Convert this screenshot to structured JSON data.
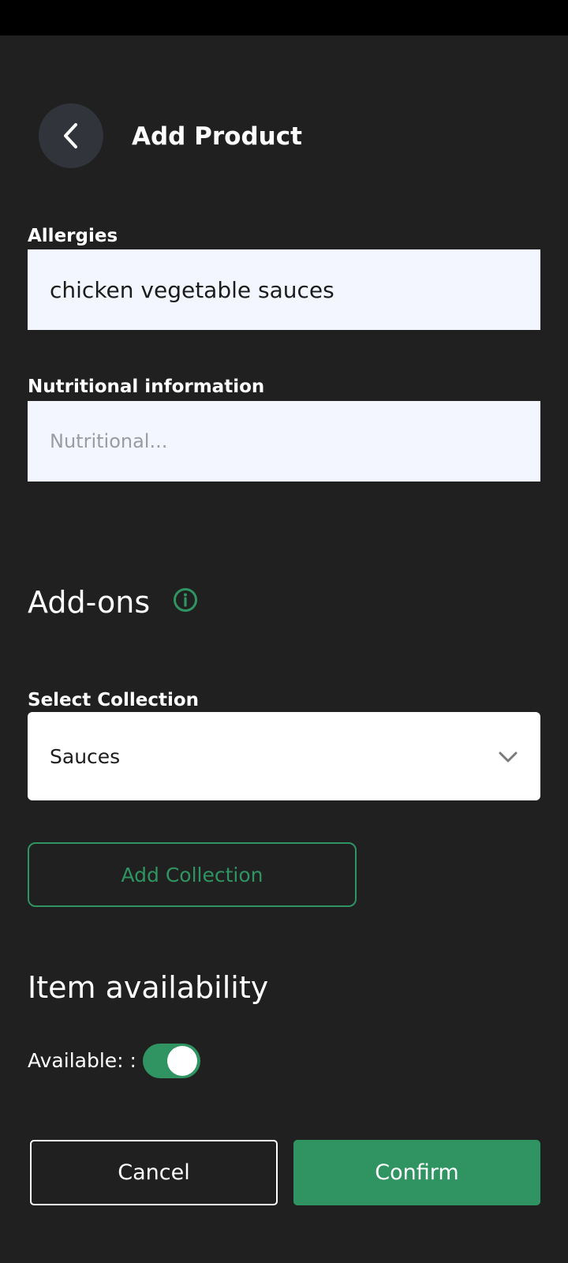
{
  "header": {
    "back_icon": "chevron-left-icon",
    "title": "Add Product"
  },
  "form": {
    "allergies": {
      "label": "Allergies",
      "value": "chicken vegetable sauces"
    },
    "nutritional": {
      "label": "Nutritional information",
      "placeholder": "Nutritional..."
    }
  },
  "addons": {
    "heading": "Add-ons",
    "info_icon": "info-icon",
    "select_label": "Select Collection",
    "selected_value": "Sauces",
    "dropdown_icon": "chevron-down-icon",
    "add_collection_label": "Add Collection"
  },
  "availability": {
    "heading": "Item availability",
    "label": "Available: :",
    "toggle_on": true
  },
  "actions": {
    "cancel_label": "Cancel",
    "confirm_label": "Confirm"
  },
  "colors": {
    "background": "#202020",
    "accent": "#2f9462",
    "input_background": "#f3f6fe",
    "back_button_background": "#31343a"
  }
}
